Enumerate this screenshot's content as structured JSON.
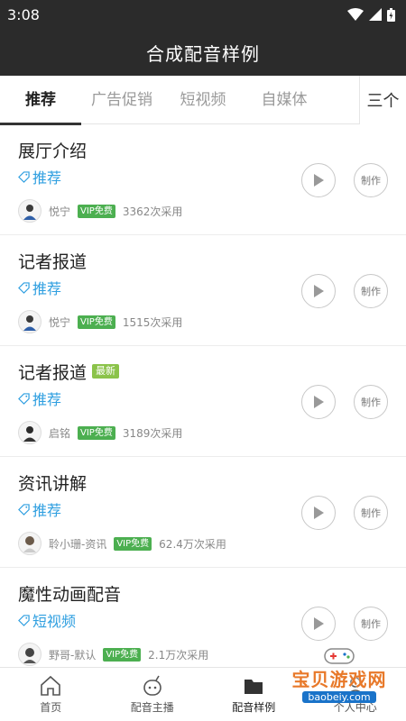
{
  "status": {
    "time": "3:08"
  },
  "title": "合成配音样例",
  "tabs": [
    "推荐",
    "广告促销",
    "短视频",
    "自媒体"
  ],
  "tab_menu_label": "三个",
  "items": [
    {
      "title": "展厅介绍",
      "badge": "",
      "tag": "推荐",
      "author": "悦宁",
      "vip": "VIP免费",
      "count": "3362次采用",
      "make": "制作"
    },
    {
      "title": "记者报道",
      "badge": "",
      "tag": "推荐",
      "author": "悦宁",
      "vip": "VIP免费",
      "count": "1515次采用",
      "make": "制作"
    },
    {
      "title": "记者报道",
      "badge": "最新",
      "tag": "推荐",
      "author": "启铭",
      "vip": "VIP免费",
      "count": "3189次采用",
      "make": "制作"
    },
    {
      "title": "资讯讲解",
      "badge": "",
      "tag": "推荐",
      "author": "聆小珊-资讯",
      "vip": "VIP免费",
      "count": "62.4万次采用",
      "make": "制作"
    },
    {
      "title": "魔性动画配音",
      "badge": "",
      "tag": "短视频",
      "author": "野哥-默认",
      "vip": "VIP免费",
      "count": "2.1万次采用",
      "make": "制作"
    }
  ],
  "bottom_nav": [
    "首页",
    "配音主播",
    "配音样例",
    "个人中心"
  ],
  "watermark": {
    "main": "宝贝游戏网",
    "sub": "baobeiy.com"
  },
  "colors": {
    "accent_blue": "#2f9fe0",
    "vip_green": "#4caf50",
    "dark_bar": "#2b2b2b"
  }
}
